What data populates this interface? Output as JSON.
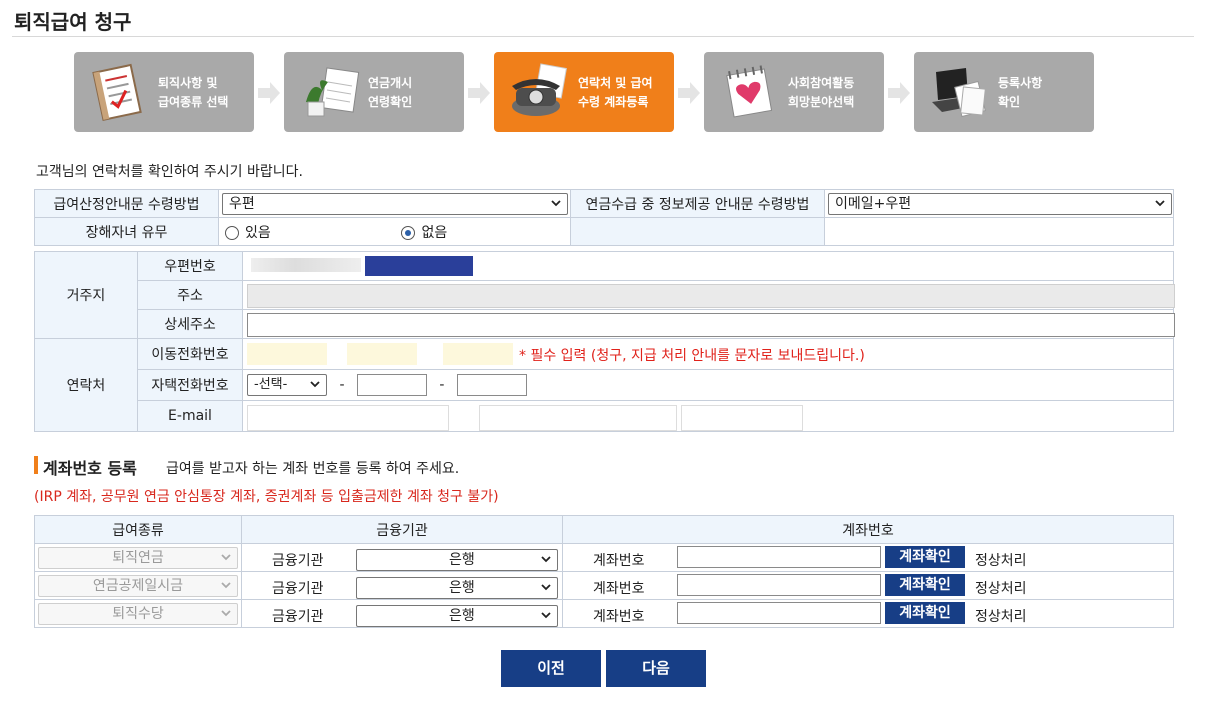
{
  "page": {
    "title": "퇴직급여 청구"
  },
  "steps": [
    {
      "label": "퇴직사항 및\n급여종류 선택",
      "icon": "notebook-checklist-icon",
      "active": false
    },
    {
      "label": "연금개시\n연령확인",
      "icon": "calendar-plant-icon",
      "active": false
    },
    {
      "label": "연락처 및 급여\n수령 계좌등록",
      "icon": "telephone-icon",
      "active": true
    },
    {
      "label": "사회참여활동\n희망분야선택",
      "icon": "heart-notebook-icon",
      "active": false
    },
    {
      "label": "등록사항\n확인",
      "icon": "laptop-documents-icon",
      "active": false
    }
  ],
  "intro": "고객님의 연락처를 확인하여 주시기 바랍니다.",
  "notice": {
    "method_label": "급여산정안내문 수령방법",
    "method_value": "우편",
    "pension_info_label": "연금수급 중 정보제공 안내문 수령방법",
    "pension_info_value": "이메일+우편",
    "disabled_child_label": "장해자녀 유무",
    "opt_yes": "있음",
    "opt_no": "없음",
    "selected": "없음"
  },
  "address": {
    "section": "거주지",
    "zip_label": "우편번호",
    "addr_label": "주소",
    "detail_label": "상세주소"
  },
  "contact": {
    "section": "연락처",
    "mobile_label": "이동전화번호",
    "mobile_required": "* 필수 입력 (청구, 지급 처리 안내를 문자로 보내드립니다.)",
    "home_label": "자택전화번호",
    "home_select": "-선택-",
    "dash": "-",
    "email_label": "E-mail"
  },
  "account_section": {
    "title": "계좌번호 등록",
    "subtitle": "급여를 받고자 하는 계좌 번호를 등록 하여 주세요.",
    "warning": "(IRP 계좌, 공무원 연금 안심통장 계좌, 증권계좌 등 입출금제한 계좌 청구 불가)",
    "headers": [
      "급여종류",
      "금융기관",
      "계좌번호"
    ],
    "rows": [
      {
        "type": "퇴직연금",
        "inst_label": "금융기관",
        "bank": "은행",
        "acct_label": "계좌번호",
        "btn": "계좌확인",
        "status": "정상처리"
      },
      {
        "type": "연금공제일시금",
        "inst_label": "금융기관",
        "bank": "은행",
        "acct_label": "계좌번호",
        "btn": "계좌확인",
        "status": "정상처리"
      },
      {
        "type": "퇴직수당",
        "inst_label": "금융기관",
        "bank": "은행",
        "acct_label": "계좌번호",
        "btn": "계좌확인",
        "status": "정상처리"
      }
    ]
  },
  "nav": {
    "prev": "이전",
    "next": "다음"
  },
  "colors": {
    "active_step": "#f07f1a",
    "inactive_step": "#a9a9a9",
    "primary_button": "#173e86",
    "required_text": "#e0221b",
    "label_bg": "#eef5fc"
  }
}
